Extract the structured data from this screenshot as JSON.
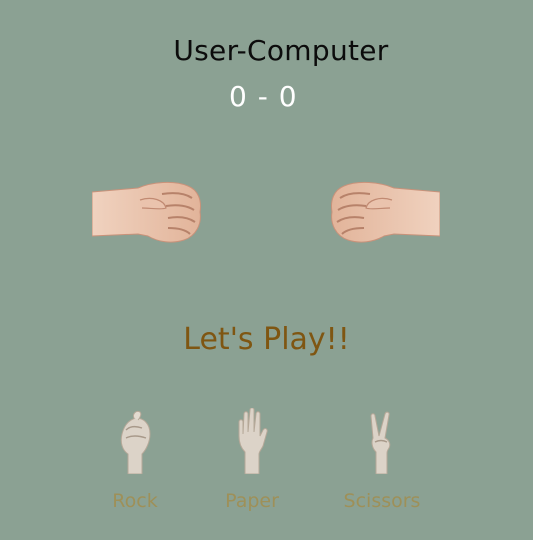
{
  "scoreboard": {
    "title": "User-Computer",
    "user_score": "0",
    "separator": "-",
    "computer_score": "0"
  },
  "hands": {
    "user_icon": "fist-icon",
    "computer_icon": "fist-icon"
  },
  "message": "Let's Play!!",
  "choices": [
    {
      "label": "Rock",
      "icon": "rock-hand-icon"
    },
    {
      "label": "Paper",
      "icon": "paper-hand-icon"
    },
    {
      "label": "Scissors",
      "icon": "scissors-hand-icon"
    }
  ],
  "colors": {
    "background": "#8ba193",
    "title": "#0c0c0c",
    "score": "#ffffff",
    "message": "#7f5612",
    "choice_label": "#9e9058",
    "skin": "#e8c4ad"
  }
}
